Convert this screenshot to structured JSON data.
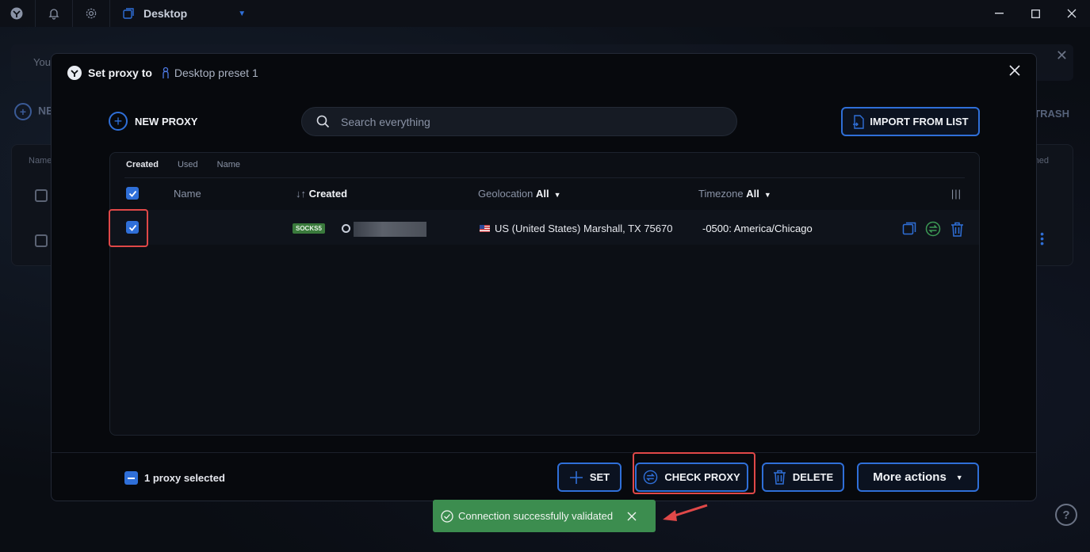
{
  "app": {
    "title": "Desktop"
  },
  "background": {
    "banner_text": "You",
    "new_label": "NE",
    "trash_label": "TRASH",
    "name_col": "Name",
    "used_col": "ned"
  },
  "modal": {
    "title": "Set proxy to",
    "subtitle": "Desktop preset 1",
    "new_proxy_label": "NEW PROXY",
    "search_placeholder": "Search everything",
    "import_label": "IMPORT FROM LIST",
    "sort_tabs": [
      "Created",
      "Used",
      "Name"
    ],
    "columns": {
      "name": "Name",
      "created_arrows": "↓↑",
      "created": "Created",
      "geolocation": "Geolocation",
      "geolocation_filter": "All",
      "timezone": "Timezone",
      "timezone_filter": "All",
      "columns_toggle": "|||"
    },
    "rows": [
      {
        "type_badge": "SOCKS5",
        "geolocation": "US (United States) Marshall, TX 75670",
        "timezone": "-0500: America/Chicago"
      }
    ],
    "footer": {
      "selected_text": "1 proxy selected",
      "set_label": "SET",
      "check_label": "CHECK PROXY",
      "delete_label": "DELETE",
      "more_label": "More actions"
    }
  },
  "toast": {
    "text": "Connection successfully validated"
  },
  "colors": {
    "accent": "#2f6fd8",
    "success": "#3c8d4f",
    "highlight": "#e04848",
    "badge": "#3a7a3c"
  }
}
